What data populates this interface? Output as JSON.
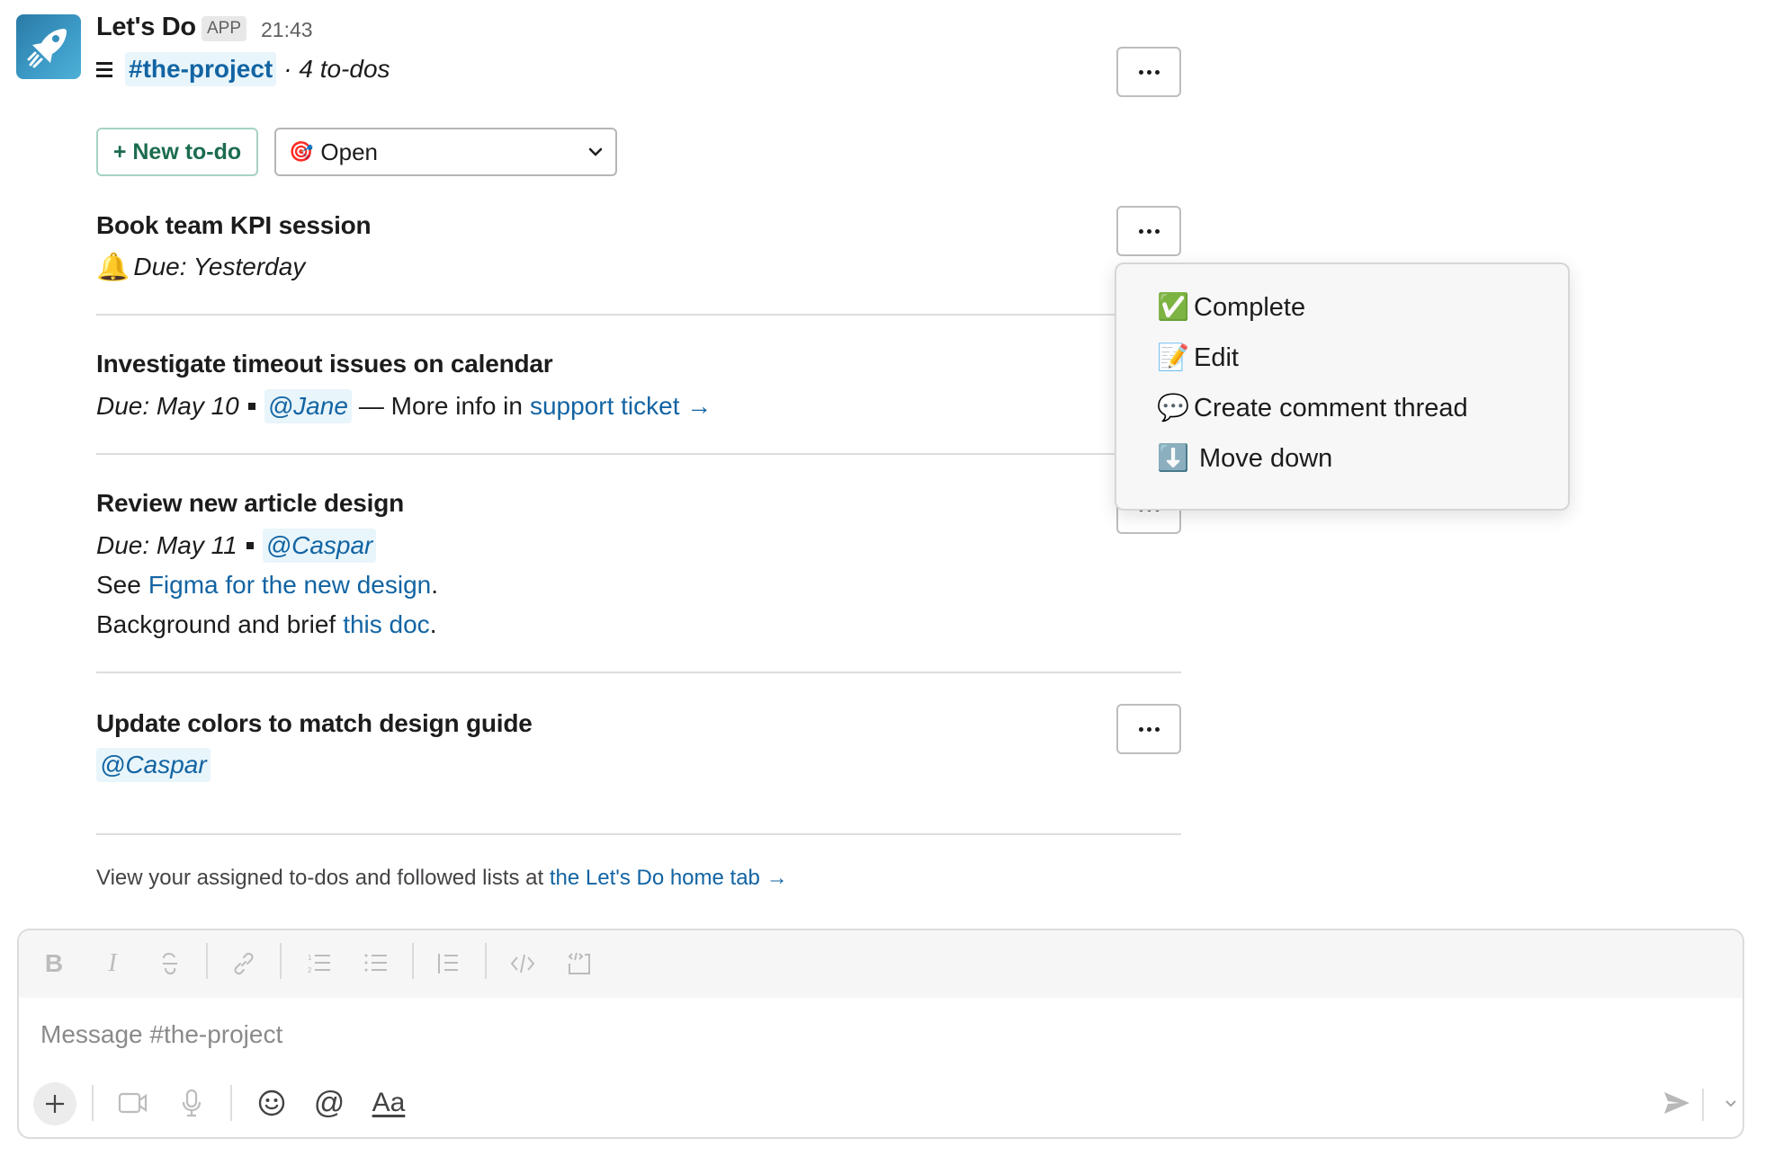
{
  "message": {
    "app_name": "Let's Do",
    "app_badge": "APP",
    "timestamp": "21:43",
    "channel": "#the-project",
    "todo_count": "· 4 to-dos",
    "new_todo_label": "+ New to-do",
    "filter": {
      "icon": "🎯",
      "selected": "Open"
    }
  },
  "todos": [
    {
      "title": "Book team KPI session",
      "bell": "🔔",
      "due": "Due: Yesterday"
    },
    {
      "title": "Investigate timeout issues on calendar",
      "due": "Due: May 10",
      "assignee": "@Jane",
      "note_prefix": "— More info in",
      "note_link": "support ticket →"
    },
    {
      "title": "Review new article design",
      "due": "Due: May 11",
      "assignee": "@Caspar",
      "line2_prefix": "See",
      "line2_link": "Figma for the new design",
      "line2_suffix": ".",
      "line3_prefix": "Background and brief",
      "line3_link": "this doc",
      "line3_suffix": "."
    },
    {
      "title": "Update colors to match design guide",
      "assignee": "@Caspar"
    }
  ],
  "footer": {
    "text": "View your assigned to-dos and followed lists at",
    "link": "the Let's Do home tab →"
  },
  "menu": {
    "items": [
      {
        "icon": "✅",
        "label": "Complete"
      },
      {
        "icon": "📝",
        "label": "Edit"
      },
      {
        "icon": "💬",
        "label": "Create comment thread"
      },
      {
        "icon": "⬇️",
        "label": "Move down"
      }
    ]
  },
  "composer": {
    "placeholder": "Message #the-project",
    "format_label": "Aa"
  },
  "colors": {
    "link": "#1264a3",
    "mention_bg": "#e8f5fa",
    "new_todo_green": "#1b6c4e"
  }
}
